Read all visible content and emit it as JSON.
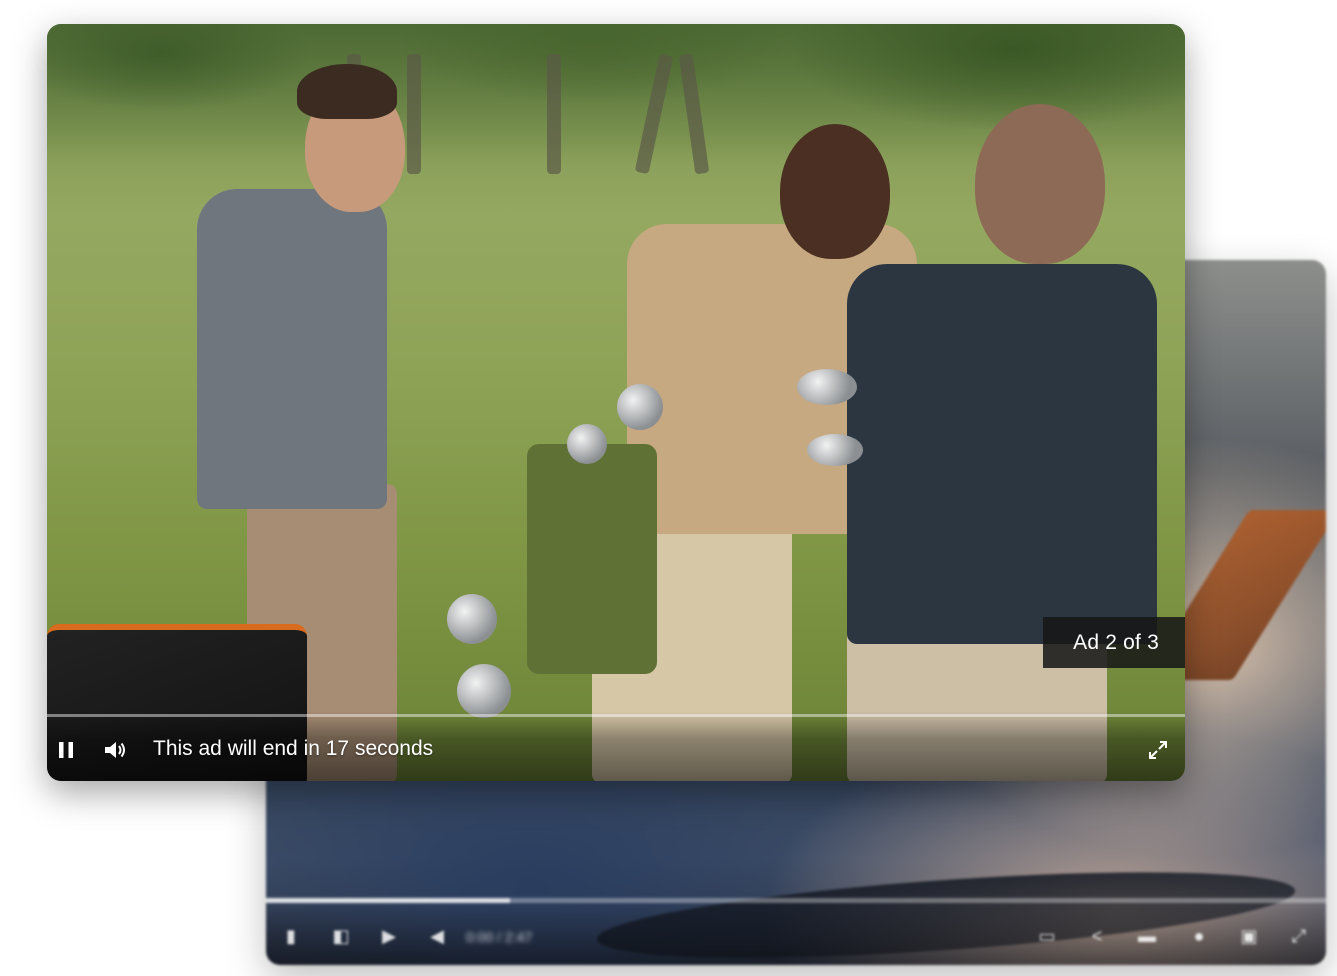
{
  "ad_player": {
    "badge": "Ad 2 of 3",
    "message": "This ad will end in 17 seconds",
    "progress": 0.0,
    "controls": {
      "play_pause": "pause-icon",
      "volume": "volume-icon",
      "fullscreen": "fullscreen-icon"
    }
  },
  "background_player": {
    "progress": 0.23,
    "time_label": "0:00 / 2:47",
    "controls": [
      "play-icon",
      "previous-icon",
      "next-icon",
      "volume-icon",
      "settings-icon",
      "share-icon",
      "captions-icon",
      "fullscreen-icon"
    ]
  },
  "colors": {
    "badge_bg": "#161616",
    "control_text": "#ffffff"
  }
}
